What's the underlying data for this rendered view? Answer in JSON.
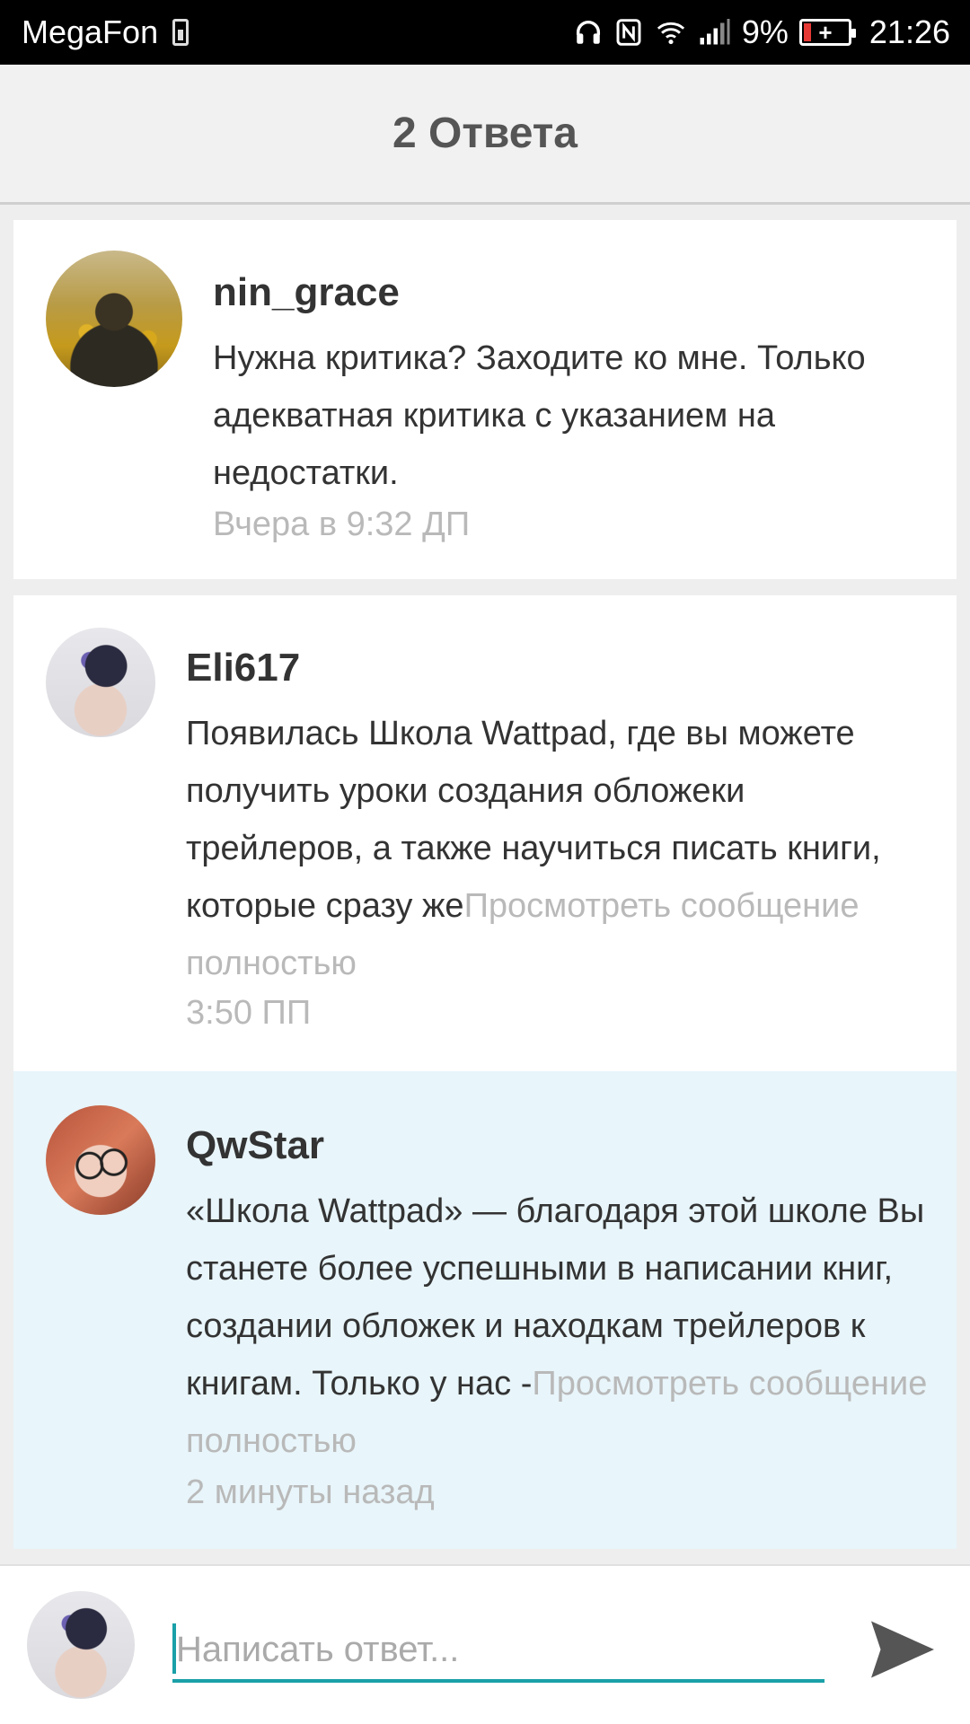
{
  "status_bar": {
    "carrier": "MegaFon",
    "battery_percent": "9%",
    "time": "21:26"
  },
  "header": {
    "title": "2 Ответа"
  },
  "comments": [
    {
      "author": "nin_grace",
      "text": "Нужна критика? Заходите ко мне. Только адекватная критика с указанием на недостатки.",
      "more": "",
      "timestamp": "Вчера в 9:32 ДП"
    },
    {
      "author": "Eli617",
      "text": "Появилась Школа Wattpad, где вы можете получить уроки создания обложеки трейлеров, а также научиться писать книги, которые сразу же",
      "more": "Просмотреть сообщение полностью",
      "timestamp": "3:50 ПП"
    },
    {
      "author": "QwStar",
      "text": "«Школа Wattpad» — благодаря этой школе Вы станете более успешными в написании книг, создании обложек и находкам трейлеров к книгам. Только у нас -",
      "more": "Просмотреть сообщение полностью",
      "timestamp": "2 минуты назад"
    }
  ],
  "reply": {
    "placeholder": "Написать ответ..."
  },
  "colors": {
    "accent": "#1aa0a8",
    "highlight_bg": "#e8f5fa",
    "muted_text": "#b9b9b9"
  }
}
